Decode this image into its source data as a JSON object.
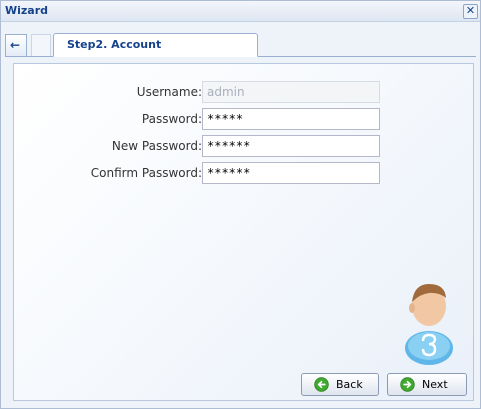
{
  "window": {
    "title": "Wizard",
    "close_glyph": "✕"
  },
  "tabs": {
    "back_glyph": "←",
    "active_label": "Step2. Account"
  },
  "form": {
    "fields": [
      {
        "label": "Username:",
        "value": "admin",
        "disabled": true
      },
      {
        "label": "Password:",
        "value": "*****",
        "disabled": false
      },
      {
        "label": "New Password:",
        "value": "******",
        "disabled": false
      },
      {
        "label": "Confirm Password:",
        "value": "******",
        "disabled": false
      }
    ]
  },
  "buttons": {
    "back_label": "Back",
    "next_label": "Next",
    "back_icon": "green-left-arrow-icon",
    "next_icon": "green-right-arrow-icon"
  },
  "colors": {
    "title_text": "#15428b",
    "icon_green": "#3fa92f"
  }
}
